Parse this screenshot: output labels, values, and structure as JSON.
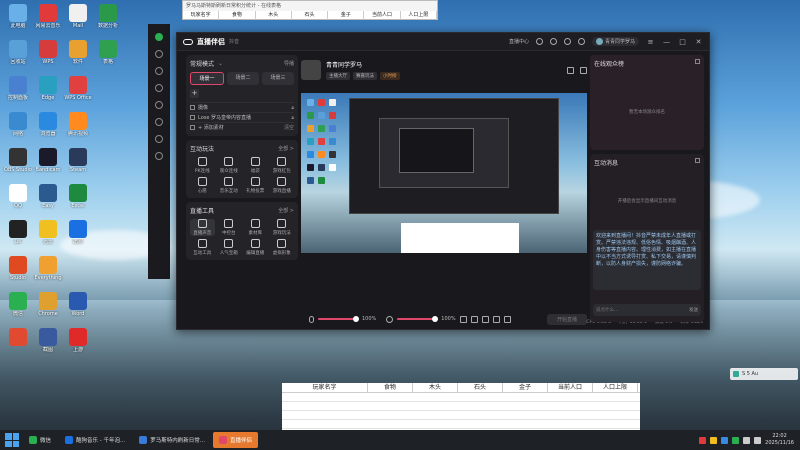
{
  "desktop": {
    "icons": [
      {
        "label": "此电脑",
        "color": "#6ab0e8"
      },
      {
        "label": "网易云音乐",
        "color": "#e03a3a"
      },
      {
        "label": "Mail",
        "color": "#f0f0f0"
      },
      {
        "label": "数据分析",
        "color": "#2a9a4a"
      },
      {
        "label": "回收站",
        "color": "#5aa0d8"
      },
      {
        "label": "WPS",
        "color": "#d63c3c"
      },
      {
        "label": "软件",
        "color": "#e8a030"
      },
      {
        "label": "表格",
        "color": "#2ea050"
      },
      {
        "label": "控制面板",
        "color": "#4a80d0"
      },
      {
        "label": "Edge",
        "color": "#2aa0c0"
      },
      {
        "label": "WPS Office",
        "color": "#e04040"
      },
      {
        "label": "",
        "color": ""
      },
      {
        "label": "网络",
        "color": "#3a8ad0"
      },
      {
        "label": "浏览器",
        "color": "#2a8ae0"
      },
      {
        "label": "腾讯视频",
        "color": "#ff8a20"
      },
      {
        "label": "",
        "color": ""
      },
      {
        "label": "OBS Studio",
        "color": "#333"
      },
      {
        "label": "Bandicam",
        "color": "#1a1a2a"
      },
      {
        "label": "Steam",
        "color": "#2a3a5a"
      },
      {
        "label": "",
        "color": ""
      },
      {
        "label": "QQ",
        "color": "#fff"
      },
      {
        "label": "Easy",
        "color": "#2a5a90"
      },
      {
        "label": "Excel",
        "color": "#1e8a40"
      },
      {
        "label": "",
        "color": ""
      },
      {
        "label": "LW",
        "color": "#222"
      },
      {
        "label": "迅雷",
        "color": "#f0c020"
      },
      {
        "label": "酷狗",
        "color": "#1a70e0"
      },
      {
        "label": "",
        "color": ""
      },
      {
        "label": "Studio",
        "color": "#e04a20"
      },
      {
        "label": "Everything",
        "color": "#f0a030"
      },
      {
        "label": "",
        "color": ""
      },
      {
        "label": "",
        "color": ""
      },
      {
        "label": "微信",
        "color": "#2ab050"
      },
      {
        "label": "Chrome",
        "color": "#e0a030"
      },
      {
        "label": "Word",
        "color": "#2a5ab0"
      },
      {
        "label": "",
        "color": ""
      },
      {
        "label": "",
        "color": "#e04a30"
      },
      {
        "label": "截图",
        "color": "#3a5aa0"
      },
      {
        "label": "上游",
        "color": "#e02a2a"
      }
    ]
  },
  "sheet_top": {
    "title": "罗马马斯特斯刷新日常积分统计 - 在线表格",
    "headers": [
      "玩家名字",
      "食物",
      "木头",
      "石头",
      "金子",
      "当前人口",
      "人口上限"
    ]
  },
  "app": {
    "title": "直播伴侣",
    "subtitle": "抖音",
    "user": "青青同学罗马",
    "status_label": "直播中心"
  },
  "scenes": {
    "mode": "常规模式",
    "guide": "导播",
    "tabs": [
      "场景一",
      "场景二",
      "场景三"
    ],
    "sources": [
      {
        "label": "摄像",
        "extra": ""
      },
      {
        "label": "Lose 罗马皇帝内容直播",
        "extra": ""
      },
      {
        "label": "+ 添加素材",
        "extra": "清空"
      }
    ]
  },
  "interactive": {
    "title": "互动玩法",
    "more": "全部 >",
    "items": [
      "PK连线",
      "观众连线",
      "福袋",
      "游戏红包",
      "心愿",
      "音乐互动",
      "礼物投票",
      "游戏直播"
    ]
  },
  "tools": {
    "title": "直播工具",
    "more": "全部 >",
    "items": [
      "直播声音",
      "中控台",
      "素材库",
      "游戏玩法",
      "互动工具",
      "人气宝箱",
      "编辑直播",
      "虚拟形象"
    ]
  },
  "stream": {
    "name": "青青同学罗马",
    "tags": [
      "主播大厅",
      "赛嘉玩法",
      "小时榜"
    ]
  },
  "controls": {
    "mic_volume": "100%",
    "speaker_volume": "100%",
    "mic_level": 0.95,
    "speaker_level": 0.95,
    "go_live": "开始直播"
  },
  "statusbar": {
    "items": [
      "CPU 0.65%",
      "内存 15.40%",
      "丢帧 0%",
      "码率 0kb/s"
    ]
  },
  "rank": {
    "title": "在线观众榜",
    "empty": "暂无本场观众排名"
  },
  "chat": {
    "title": "互动消息",
    "empty": "开播后会显示直播间互动消息",
    "notice": "欢迎来到直播间！抖音严禁未成年人直播或打赏。严禁违法违规、低俗色情、吸烟酗酒、人身伤害等直播内容。理性消费，如主播在直播中以不当方式诱导打赏、私下交易，请谨慎判断，以防人身财产损失，谨防网络诈骗。",
    "placeholder": "说点什么...",
    "send": "发送"
  },
  "sheet_bottom": {
    "headers": [
      "玩家名字",
      "食物",
      "木头",
      "石头",
      "金子",
      "当前人口",
      "人口上限"
    ]
  },
  "notification": {
    "text": "S 5 Au"
  },
  "taskbar": {
    "items": [
      {
        "label": "微信",
        "color": "#2ab050",
        "active": false
      },
      {
        "label": "酷狗音乐 - 千年泡...",
        "color": "#1a70e0",
        "active": false
      },
      {
        "label": "罗马斯特内刷新日常...",
        "color": "#3a7ad8",
        "active": false
      },
      {
        "label": "直播伴侣",
        "color": "#e0486b",
        "active": true
      }
    ],
    "time": "22:02",
    "date": "2025/11/16"
  }
}
